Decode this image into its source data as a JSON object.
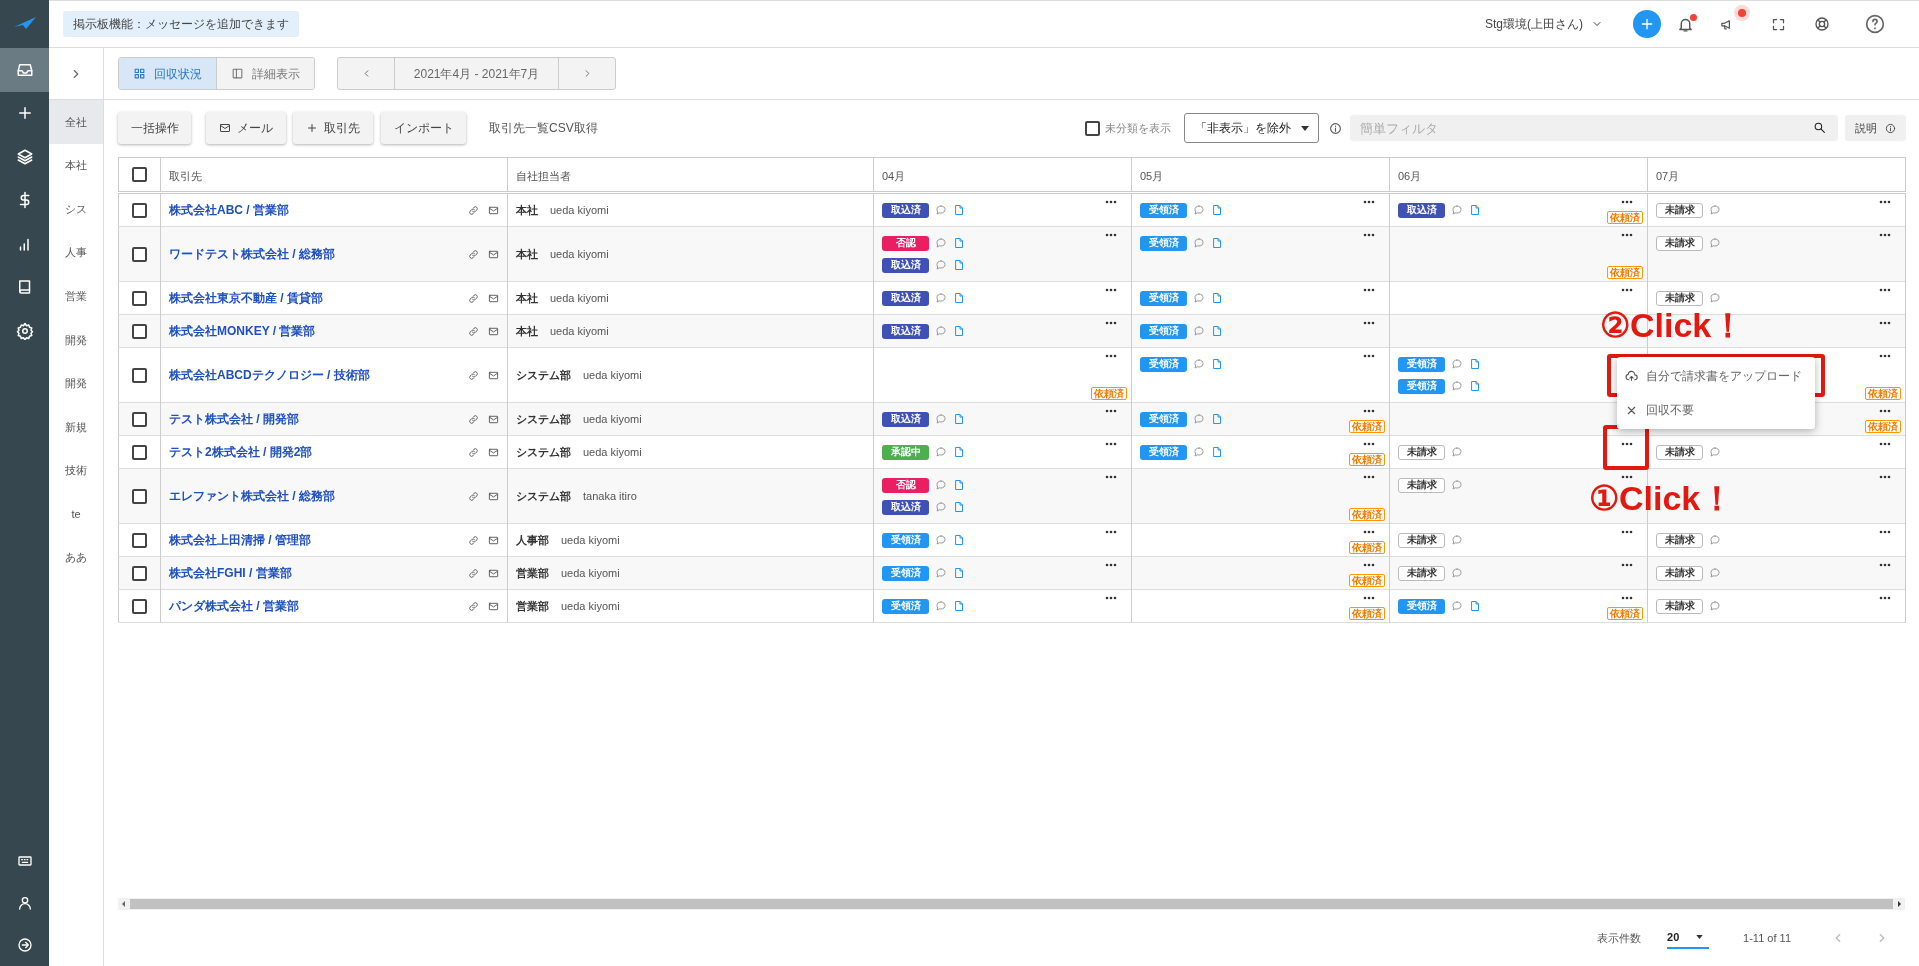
{
  "header": {
    "notice": "掲示板機能：メッセージを追加できます",
    "account": "Stg環境(上田さん)",
    "bell_unread": true,
    "announcement_unread": true
  },
  "nav_items": [
    {
      "selected": true
    },
    {
      "selected": false
    },
    {
      "selected": false
    },
    {
      "selected": false
    },
    {
      "selected": false
    },
    {
      "selected": false
    },
    {
      "selected": false
    }
  ],
  "sub_sidebar": {
    "items": [
      {
        "label": "全社",
        "selected": true
      },
      {
        "label": "本社",
        "selected": false
      },
      {
        "label": "シス",
        "selected": false
      },
      {
        "label": "人事",
        "selected": false
      },
      {
        "label": "営業",
        "selected": false
      },
      {
        "label": "開発",
        "selected": false
      },
      {
        "label": "開発",
        "selected": false
      },
      {
        "label": "新規",
        "selected": false
      },
      {
        "label": "技術",
        "selected": false
      },
      {
        "label": "te",
        "selected": false
      },
      {
        "label": "ああ",
        "selected": false
      }
    ]
  },
  "view_tabs": [
    {
      "label": "回収状況",
      "selected": true
    },
    {
      "label": "詳細表示",
      "selected": false
    }
  ],
  "period": "2021年4月 - 2021年7月",
  "actions": [
    {
      "label": "一括操作"
    },
    {
      "label": "メール"
    },
    {
      "label": "取引先"
    },
    {
      "label": "インポート"
    }
  ],
  "csv_link": "取引先一覧CSV取得",
  "show_uncategorized": {
    "label": "未分類を表示",
    "checked": false
  },
  "visibility_filter": "「非表示」を除外",
  "search": {
    "placeholder": "簡単フィルタ"
  },
  "help_button": "説明",
  "table": {
    "select_all_checked": false,
    "columns": [
      "取引先",
      "自社担当者",
      "04月",
      "05月",
      "06月",
      "07月"
    ],
    "rows": [
      {
        "checked": false,
        "client": "株式会社ABC / 営業部",
        "department": "本社",
        "person": "ueda kiyomi",
        "months": [
          {
            "entries": [
              {
                "kind": "imported",
                "label": "取込済",
                "document": true
              }
            ],
            "menu": true
          },
          {
            "entries": [
              {
                "kind": "received",
                "label": "受領済",
                "document": true
              }
            ],
            "menu": true
          },
          {
            "entries": [
              {
                "kind": "imported",
                "label": "取込済",
                "document": true
              }
            ],
            "menu": true,
            "tag": "依頼済"
          },
          {
            "entries": [
              {
                "kind": "unbilled",
                "label": "未請求",
                "document": false
              }
            ],
            "menu": true
          }
        ]
      },
      {
        "checked": false,
        "client": "ワードテスト株式会社 / 総務部",
        "department": "本社",
        "person": "ueda kiyomi",
        "months": [
          {
            "entries": [
              {
                "kind": "rejected",
                "label": "否認",
                "document": true
              },
              {
                "kind": "imported",
                "label": "取込済",
                "document": true
              }
            ],
            "menu": true
          },
          {
            "entries": [
              {
                "kind": "received",
                "label": "受領済",
                "document": true
              }
            ],
            "menu": true
          },
          {
            "menu": true,
            "tag": "依頼済"
          },
          {
            "entries": [
              {
                "kind": "unbilled",
                "label": "未請求",
                "document": false
              }
            ],
            "menu": true
          }
        ]
      },
      {
        "checked": false,
        "client": "株式会社東京不動産 / 賃貸部",
        "department": "本社",
        "person": "ueda kiyomi",
        "months": [
          {
            "entries": [
              {
                "kind": "imported",
                "label": "取込済",
                "document": true
              }
            ],
            "menu": true
          },
          {
            "entries": [
              {
                "kind": "received",
                "label": "受領済",
                "document": true
              }
            ],
            "menu": true
          },
          {
            "menu": true
          },
          {
            "entries": [
              {
                "kind": "unbilled",
                "label": "未請求",
                "document": false
              }
            ],
            "menu": true
          }
        ]
      },
      {
        "checked": false,
        "client": "株式会社MONKEY / 営業部",
        "department": "本社",
        "person": "ueda kiyomi",
        "months": [
          {
            "entries": [
              {
                "kind": "imported",
                "label": "取込済",
                "document": true
              }
            ],
            "menu": true
          },
          {
            "entries": [
              {
                "kind": "received",
                "label": "受領済",
                "document": true
              }
            ],
            "menu": true
          },
          {
            "menu": false
          },
          {
            "menu": true
          }
        ]
      },
      {
        "checked": false,
        "client": "株式会社ABCDテクノロジー / 技術部",
        "department": "システム部",
        "person": "ueda kiyomi",
        "months": [
          {
            "menu": true,
            "tag": "依頼済"
          },
          {
            "entries": [
              {
                "kind": "received",
                "label": "受領済",
                "document": true
              }
            ],
            "menu": true
          },
          {
            "entries": [
              {
                "kind": "received",
                "label": "受領済",
                "document": true
              },
              {
                "kind": "received",
                "label": "受領済",
                "document": true
              }
            ],
            "menu": false
          },
          {
            "menu": true,
            "tag": "依頼済"
          }
        ]
      },
      {
        "checked": false,
        "client": "テスト株式会社 / 開発部",
        "department": "システム部",
        "person": "ueda kiyomi",
        "months": [
          {
            "entries": [
              {
                "kind": "imported",
                "label": "取込済",
                "document": true
              }
            ],
            "menu": true
          },
          {
            "entries": [
              {
                "kind": "received",
                "label": "受領済",
                "document": true
              }
            ],
            "menu": true,
            "tag": "依頼済"
          },
          {
            "menu": false
          },
          {
            "menu": true,
            "tag": "依頼済"
          }
        ]
      },
      {
        "checked": false,
        "client": "テスト2株式会社 / 開発2部",
        "department": "システム部",
        "person": "ueda kiyomi",
        "months": [
          {
            "entries": [
              {
                "kind": "approving",
                "label": "承認中",
                "document": true
              }
            ],
            "menu": true
          },
          {
            "entries": [
              {
                "kind": "received",
                "label": "受領済",
                "document": true
              }
            ],
            "menu": true,
            "tag": "依頼済"
          },
          {
            "entries": [
              {
                "kind": "unbilled",
                "label": "未請求",
                "document": false
              }
            ],
            "menu": true
          },
          {
            "entries": [
              {
                "kind": "unbilled",
                "label": "未請求",
                "document": false
              }
            ],
            "menu": true
          }
        ]
      },
      {
        "checked": false,
        "client": "エレファント株式会社 / 総務部",
        "department": "システム部",
        "person": "tanaka itiro",
        "months": [
          {
            "entries": [
              {
                "kind": "rejected",
                "label": "否認",
                "document": true
              },
              {
                "kind": "imported",
                "label": "取込済",
                "document": true
              }
            ],
            "menu": true
          },
          {
            "menu": true,
            "tag": "依頼済"
          },
          {
            "entries": [
              {
                "kind": "unbilled",
                "label": "未請求",
                "document": false
              }
            ],
            "menu": true
          },
          {
            "menu": true
          }
        ]
      },
      {
        "checked": false,
        "client": "株式会社上田清掃 / 管理部",
        "department": "人事部",
        "person": "ueda kiyomi",
        "months": [
          {
            "entries": [
              {
                "kind": "received",
                "label": "受領済",
                "document": true
              }
            ],
            "menu": true
          },
          {
            "menu": true,
            "tag": "依頼済"
          },
          {
            "entries": [
              {
                "kind": "unbilled",
                "label": "未請求",
                "document": false
              }
            ],
            "menu": true
          },
          {
            "entries": [
              {
                "kind": "unbilled",
                "label": "未請求",
                "document": false
              }
            ],
            "menu": true
          }
        ]
      },
      {
        "checked": false,
        "client": "株式会社FGHI / 営業部",
        "department": "営業部",
        "person": "ueda kiyomi",
        "months": [
          {
            "entries": [
              {
                "kind": "received",
                "label": "受領済",
                "document": true
              }
            ],
            "menu": true
          },
          {
            "menu": true,
            "tag": "依頼済"
          },
          {
            "entries": [
              {
                "kind": "unbilled",
                "label": "未請求",
                "document": false
              }
            ],
            "menu": true
          },
          {
            "entries": [
              {
                "kind": "unbilled",
                "label": "未請求",
                "document": false
              }
            ],
            "menu": true
          }
        ]
      },
      {
        "checked": false,
        "client": "パンダ株式会社 / 営業部",
        "department": "営業部",
        "person": "ueda kiyomi",
        "months": [
          {
            "entries": [
              {
                "kind": "received",
                "label": "受領済",
                "document": true
              }
            ],
            "menu": true
          },
          {
            "menu": true,
            "tag": "依頼済"
          },
          {
            "entries": [
              {
                "kind": "received",
                "label": "受領済",
                "document": true
              }
            ],
            "menu": true,
            "tag": "依頼済"
          },
          {
            "entries": [
              {
                "kind": "unbilled",
                "label": "未請求",
                "document": false
              }
            ],
            "menu": true
          }
        ]
      }
    ]
  },
  "context_menu": {
    "items": [
      {
        "label": "自分で請求書をアップロード"
      },
      {
        "label": "回収不要"
      }
    ]
  },
  "annotations": [
    {
      "text": "②Click！"
    },
    {
      "text": "①Click！"
    }
  ],
  "pagination": {
    "per_page_label": "表示件数",
    "per_page": "20",
    "range": "1-11 of 11"
  }
}
